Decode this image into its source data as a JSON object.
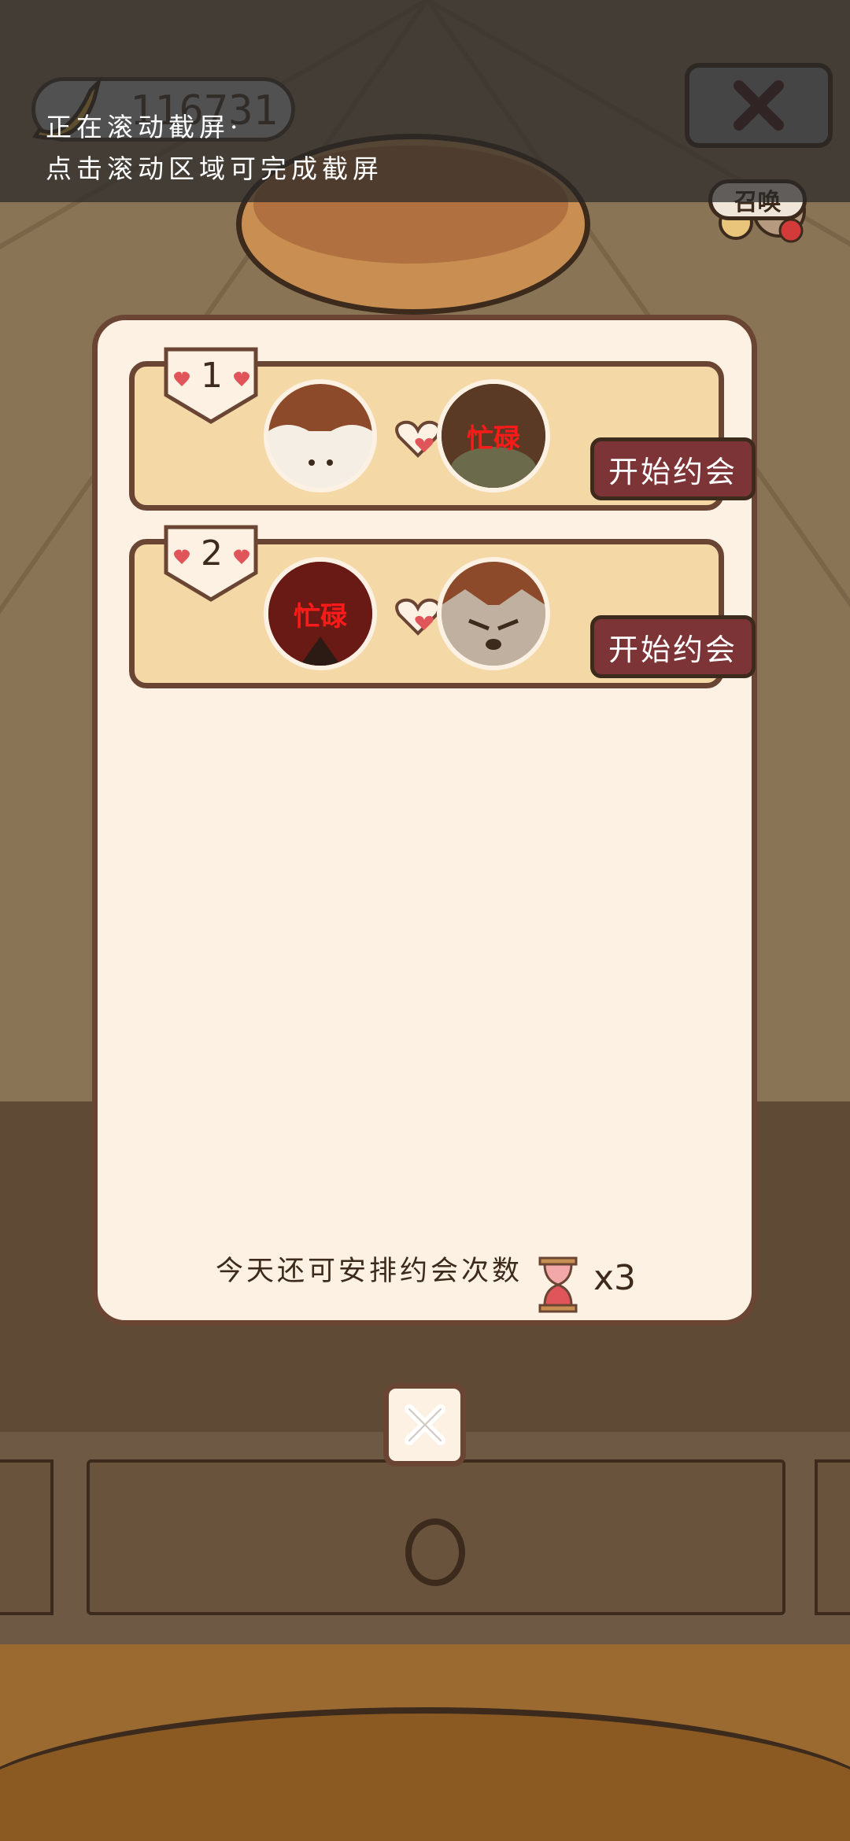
{
  "top_bar": {
    "coin_value": "116731",
    "summon_label": "召唤"
  },
  "banner": {
    "line1": "正在滚动截屏·",
    "line2": "点击滚动区域可完成截屏"
  },
  "dialog": {
    "pairs": [
      {
        "rank": "1",
        "left_busy": "",
        "right_busy": "忙碌",
        "button": "开始约会"
      },
      {
        "rank": "2",
        "left_busy": "忙碌",
        "right_busy": "",
        "button": "开始约会"
      }
    ],
    "remaining_label": "今天还可安排约会次数",
    "remaining_count": "x3"
  },
  "colors": {
    "dialog_bg": "#fcf1e2",
    "card_bg": "#f4d8a6",
    "button_bg": "#7d3437",
    "busy_text": "#ff1a1a",
    "outline": "#3c2a1c"
  },
  "icons": [
    "banana-icon",
    "close-icon",
    "heart-icon",
    "hourglass-icon"
  ]
}
